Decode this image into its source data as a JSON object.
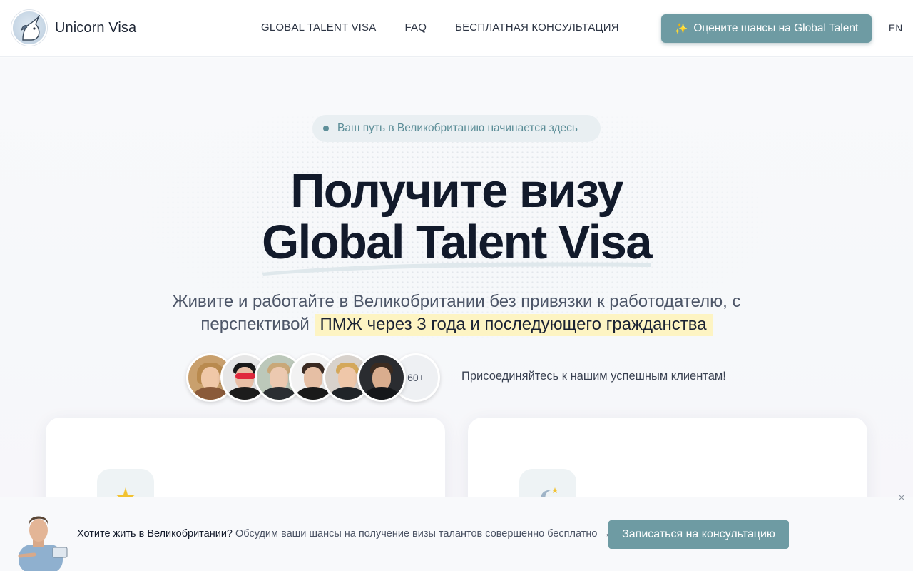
{
  "header": {
    "brand_name": "Unicorn Visa",
    "nav": [
      {
        "label": "GLOBAL TALENT VISA"
      },
      {
        "label": "FAQ"
      },
      {
        "label": "БЕСПЛАТНАЯ КОНСУЛЬТАЦИЯ"
      }
    ],
    "cta_label": "Оцените шансы на Global Talent",
    "cta_icon": "sparkles-icon",
    "lang_label": "EN"
  },
  "hero": {
    "pill_text": "Ваш путь в Великобританию начинается здесь",
    "title_line1": "Получите визу",
    "title_line2": "Global Talent Visa",
    "subtitle_part1": "Живите и работайте в Великобритании без привязки к работодателю, с",
    "subtitle_part2": "перспективой",
    "subtitle_highlight": "ПМЖ через 3 года и последующего гражданства",
    "clients_count": "60+",
    "join_text": "Присоединяйтесь к нашим успешным клиентам!"
  },
  "banner": {
    "strong_text": "Хотите жить в Великобритании?",
    "rest_text": "Обсудим ваши шансы на получение визы талантов совершенно бесплатно →",
    "cta_label": "Записаться на консультацию",
    "close_glyph": "×"
  },
  "colors": {
    "accent": "#6e9ba3",
    "title": "#121a2b",
    "highlight_bg": "#fdf4c3",
    "pill_bg": "#e9eff2",
    "pill_text": "#5b8d97"
  }
}
